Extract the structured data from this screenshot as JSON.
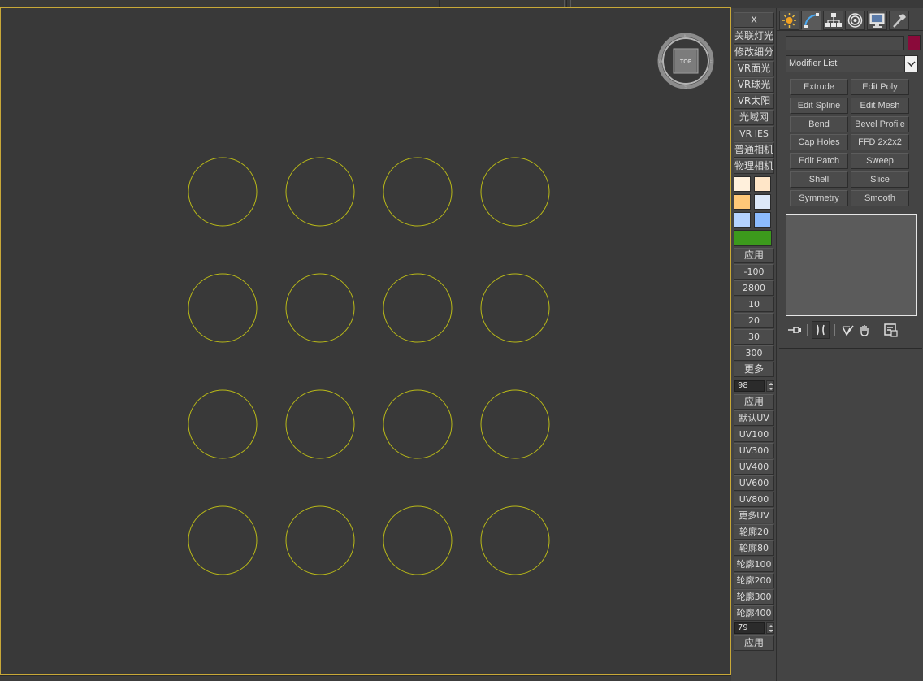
{
  "viewport": {
    "circle_color": "#b8b818",
    "background": "#393939",
    "border_color": "#c8a838",
    "viewcube_label": "TOP"
  },
  "toolcol": {
    "close_label": "X",
    "lighting_buttons": [
      "关联灯光",
      "修改细分",
      "VR面光",
      "VR球光",
      "VR太阳",
      "光域网",
      "VR IES",
      "普通相机",
      "物理相机"
    ],
    "swatch_colors": [
      "#fff0dc",
      "#ffe6c8",
      "#ffc878",
      "#dce8f8",
      "#b4d2ff",
      "#8cbcff"
    ],
    "green_swatch_color": "#3c9a1c",
    "apply_label_1": "应用",
    "value_buttons": [
      "-100",
      "2800",
      "10",
      "20",
      "30",
      "300"
    ],
    "more_label": "更多",
    "spinner_1_value": "98",
    "apply_label_2": "应用",
    "uv_buttons": [
      "默认UV",
      "UV100",
      "UV300",
      "UV400",
      "UV600",
      "UV800",
      "更多UV"
    ],
    "outline_buttons": [
      "轮廓20",
      "轮廓80",
      "轮廓100",
      "轮廓200",
      "轮廓300",
      "轮廓400"
    ],
    "spinner_2_value": "79",
    "apply_label_3": "应用"
  },
  "cmdpanel": {
    "tabs": [
      "create-tab",
      "modify-tab",
      "hierarchy-tab",
      "motion-tab",
      "display-tab",
      "utilities-tab"
    ],
    "object_color": "#8a0a3a",
    "modifier_list_label": "Modifier List",
    "modifier_buttons": [
      [
        "Extrude",
        "Edit Poly"
      ],
      [
        "Edit Spline",
        "Edit Mesh"
      ],
      [
        "Bend",
        "Bevel Profile"
      ],
      [
        "Cap Holes",
        "FFD 2x2x2"
      ],
      [
        "Edit Patch",
        "Sweep"
      ],
      [
        "Shell",
        "Slice"
      ],
      [
        "Symmetry",
        "Smooth"
      ]
    ]
  }
}
